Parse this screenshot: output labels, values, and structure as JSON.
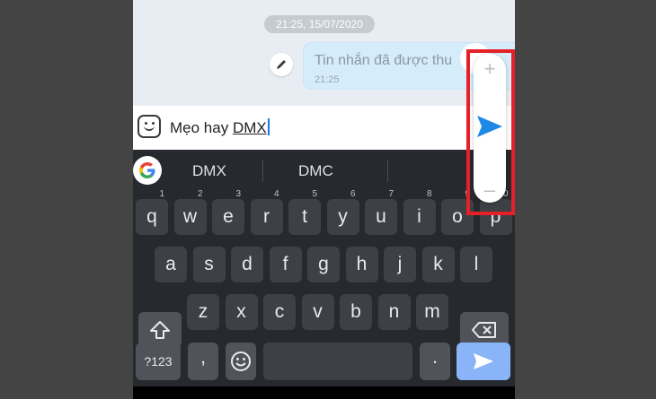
{
  "chat": {
    "date_label": "21:25, 15/07/2020",
    "message_text": "Tin nhắn đã được thu",
    "message_time": "21:25"
  },
  "input": {
    "text_prefix": "Mẹo hay ",
    "text_composing": "DMX"
  },
  "keyboard": {
    "suggestions": [
      "DMX",
      "DMC"
    ],
    "row1": [
      {
        "k": "q",
        "h": "1"
      },
      {
        "k": "w",
        "h": "2"
      },
      {
        "k": "e",
        "h": "3"
      },
      {
        "k": "r",
        "h": "4"
      },
      {
        "k": "t",
        "h": "5"
      },
      {
        "k": "y",
        "h": "6"
      },
      {
        "k": "u",
        "h": "7"
      },
      {
        "k": "i",
        "h": "8"
      },
      {
        "k": "o",
        "h": "9"
      },
      {
        "k": "p",
        "h": "0"
      }
    ],
    "row2": [
      "a",
      "s",
      "d",
      "f",
      "g",
      "h",
      "j",
      "k",
      "l"
    ],
    "row3": [
      "z",
      "x",
      "c",
      "v",
      "b",
      "n",
      "m"
    ],
    "numbers_label": "?123",
    "comma_label": ",",
    "period_label": "."
  },
  "size_control": {
    "plus_label": "+",
    "minus_label": "–"
  },
  "colors": {
    "send_blue": "#1e88e5",
    "highlight_red": "#e52028",
    "enter_key": "#8ab4f8"
  },
  "icons": {
    "edit": "pencil-icon",
    "emoji": "emoji-icon",
    "google": "google-logo",
    "shift": "shift-icon",
    "backspace": "backspace-icon",
    "send": "send-icon"
  }
}
